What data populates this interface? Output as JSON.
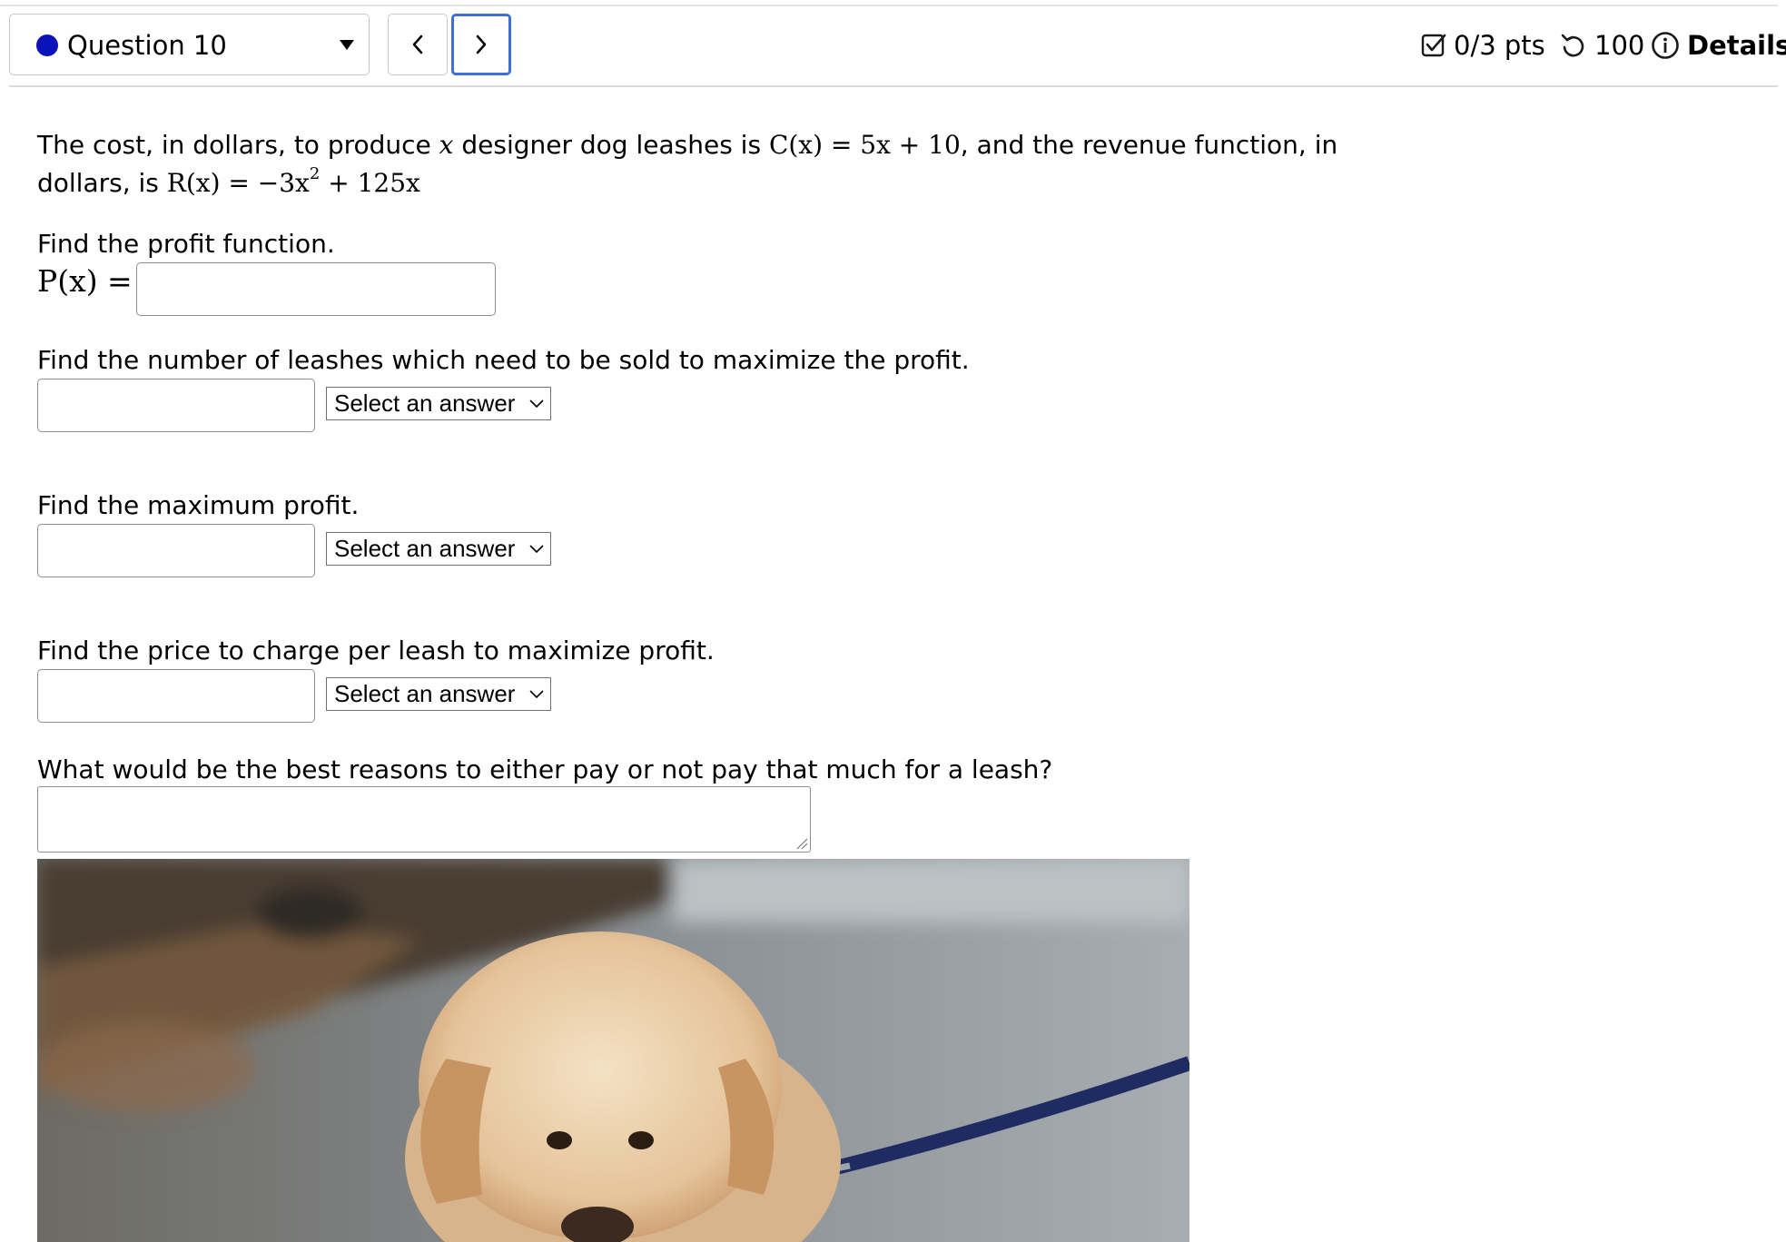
{
  "header": {
    "question_label": "Question 10",
    "points": "0/3 pts",
    "attempts": "100",
    "details": "Details"
  },
  "problem": {
    "intro_1": "The cost, in dollars, to produce ",
    "var_x": "x",
    "intro_2": " designer dog leashes is ",
    "cost_fn": "C(x) = 5x + 10",
    "intro_3": ", and the revenue function, in",
    "intro_4": "dollars, is ",
    "rev_fn_a": "R(x) = −3x",
    "rev_exp": "2",
    "rev_fn_b": " + 125x"
  },
  "q1": {
    "prompt": "Find the profit function.",
    "label": "P(x) ="
  },
  "q2": {
    "prompt": "Find the number of leashes which need to be sold to maximize the profit.",
    "select": "Select an answer"
  },
  "q3": {
    "prompt": "Find the maximum profit.",
    "select": "Select an answer"
  },
  "q4": {
    "prompt": "Find the price to charge per leash to maximize profit.",
    "select": "Select an answer"
  },
  "q5": {
    "prompt": "What would be the best reasons to either pay or not pay that much for a leash?"
  }
}
